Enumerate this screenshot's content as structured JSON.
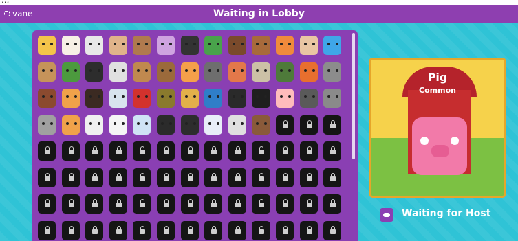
{
  "caption": "...",
  "header": {
    "user": "vane",
    "title": "Waiting in Lobby"
  },
  "grid": {
    "rows": [
      {
        "cells": [
          "duck",
          "chicken",
          "cow",
          "pig",
          "moose",
          "star-slot",
          "zebra",
          "frog",
          "bear",
          "puppy",
          "fox",
          "rabbit",
          "goldfish"
        ],
        "locked": [
          false,
          false,
          false,
          false,
          false,
          false,
          false,
          false,
          false,
          false,
          false,
          false,
          false
        ]
      },
      {
        "cells": [
          "bear-cub",
          "frog",
          "cat",
          "husky",
          "reindeer",
          "moose",
          "fox",
          "raccoon",
          "fox",
          "owl",
          "hedgehog",
          "squirrel",
          "wolf"
        ],
        "locked": [
          false,
          false,
          false,
          false,
          false,
          false,
          false,
          false,
          false,
          false,
          false,
          false,
          false
        ]
      },
      {
        "cells": [
          "boar",
          "tiger",
          "buffalo",
          "snowy-owl",
          "parrot",
          "pine",
          "leopard",
          "macaw",
          "toucan",
          "panther",
          "sloth",
          "raccoon",
          "elephant"
        ],
        "locked": [
          false,
          false,
          false,
          false,
          false,
          false,
          false,
          false,
          false,
          false,
          false,
          false,
          false
        ]
      },
      {
        "cells": [
          "rhino",
          "tiger",
          "snowy-owl",
          "polar-bear",
          "arctic-fox",
          "penguin",
          "penguin",
          "arctic-fox",
          "seal",
          "walrus",
          "locked",
          "locked",
          "locked"
        ],
        "locked": [
          false,
          false,
          false,
          false,
          false,
          false,
          false,
          false,
          false,
          false,
          true,
          true,
          true
        ]
      },
      {
        "cells": [
          "locked",
          "locked",
          "locked",
          "locked",
          "locked",
          "locked",
          "locked",
          "locked",
          "locked",
          "locked",
          "locked",
          "locked",
          "locked"
        ],
        "locked": [
          true,
          true,
          true,
          true,
          true,
          true,
          true,
          true,
          true,
          true,
          true,
          true,
          true
        ]
      },
      {
        "cells": [
          "locked",
          "locked",
          "locked",
          "locked",
          "locked",
          "locked",
          "locked",
          "locked",
          "locked",
          "locked",
          "locked",
          "locked",
          "locked"
        ],
        "locked": [
          true,
          true,
          true,
          true,
          true,
          true,
          true,
          true,
          true,
          true,
          true,
          true,
          true
        ]
      },
      {
        "cells": [
          "locked",
          "locked",
          "locked",
          "locked",
          "locked",
          "locked",
          "locked",
          "locked",
          "locked",
          "locked",
          "locked",
          "locked",
          "locked"
        ],
        "locked": [
          true,
          true,
          true,
          true,
          true,
          true,
          true,
          true,
          true,
          true,
          true,
          true,
          true
        ]
      },
      {
        "cells": [
          "locked",
          "locked",
          "locked",
          "locked",
          "locked",
          "locked",
          "locked",
          "locked",
          "locked",
          "locked",
          "locked",
          "locked",
          "locked"
        ],
        "locked": [
          true,
          true,
          true,
          true,
          true,
          true,
          true,
          true,
          true,
          true,
          true,
          true,
          true
        ]
      }
    ]
  },
  "preview": {
    "name": "Pig",
    "rarity": "Common"
  },
  "status": {
    "label": "Waiting for Host"
  },
  "colors": {
    "bar": "#8e3fb0",
    "panel": "#8a3fb3",
    "background": "#2fc3d6"
  },
  "icons": {
    "user": "fullscreen-icon",
    "status": "gamepad-icon"
  }
}
